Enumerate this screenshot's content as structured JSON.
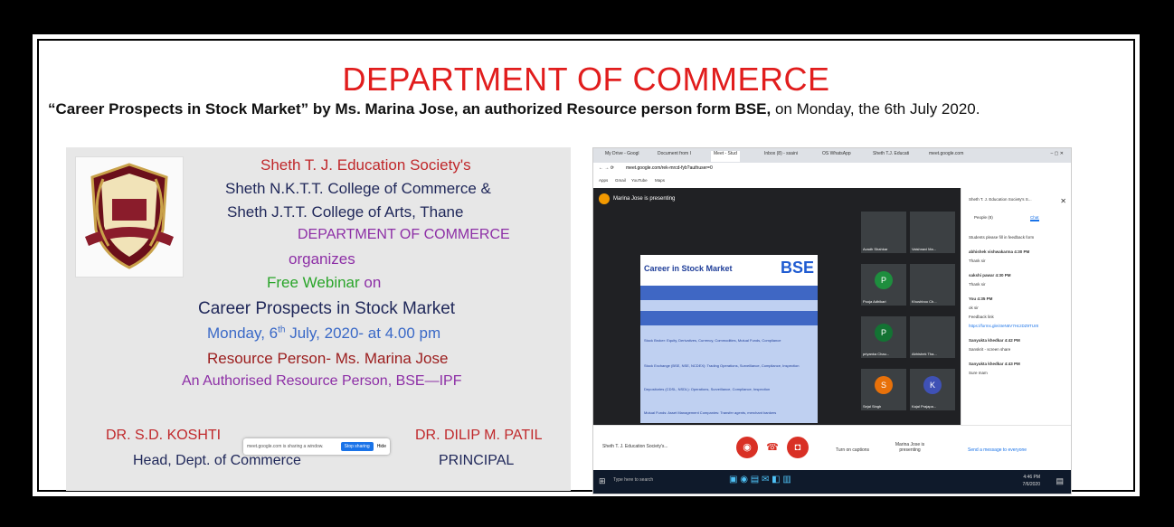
{
  "header": {
    "title": "DEPARTMENT OF COMMERCE",
    "subtitle_bold": "“Career Prospects in Stock Market” by Ms. Marina Jose, an authorized Resource person form BSE,",
    "subtitle_rest": " on Monday, the 6th July 2020."
  },
  "poster": {
    "lines": [
      "Sheth T. J. Education Society's",
      "Sheth N.K.T.T. College of Commerce  &",
      "Sheth J.T.T. College of Arts, Thane",
      "DEPARTMENT OF COMMERCE",
      "organizes",
      "Free Webinar",
      " on",
      "Career Prospects in Stock Market",
      "Monday, 6",
      "th",
      " July, 2020- at 4.00 pm",
      "Resource Person- Ms. Marina Jose",
      "An Authorised Resource Person, BSE—IPF"
    ],
    "left_sign_name": "DR. S.D. KOSHTI",
    "left_sign_title": "Head, Dept. of Commerce",
    "right_sign_name": "DR. DILIP M. PATIL",
    "right_sign_title": "PRINCIPAL",
    "share_bar_text": "meet.google.com is sharing a window.",
    "stop_sharing": "Stop sharing",
    "hide": "Hide"
  },
  "screen": {
    "tabs": [
      "My Drive - Googl",
      "Document from I",
      "Meet - Stud",
      "Inbox (8) - ssaini",
      "OS WhatsApp",
      "Sheth T.J. Educati",
      "meet.google.com"
    ],
    "url": "meet.google.com/rek-mrcd-fyb?authuser=0",
    "bookmarks": [
      "Apps",
      "Gmail",
      "YouTube",
      "Maps"
    ],
    "presenting": "Marina Jose is presenting",
    "slide_title": "Career in Stock Market",
    "slide_logo": "BSE",
    "slide_rows": [
      "Stock Broker: Equity, Derivatives, Currency, Commodities, Mutual Funds, Compliance",
      "Stock Exchange (BSE, NSE, NCDEX): Trading Operations, Surveillance, Compliance, Inspection",
      "Depositories (CDSL, NSDL): Operations, Surveillance, Compliance, Inspection",
      "Mutual Funds: Asset Management Companies: Transfer agents, merchant bankers"
    ],
    "participants": [
      "Avadh Shahkar",
      "Vaishnavi Ma...",
      "Pooja Adhikari",
      "Khushboo Ch...",
      "priyanka Chau...",
      "Abhishek Tha...",
      "Sejal Singh",
      "Kajal Prajapa..."
    ],
    "side_title": "Sheth T. J. Education Society's S...",
    "people_tab": "People (8)",
    "chat_tab": "Chat",
    "chat": [
      "Students please fill in feedback form",
      "abhishek vishwakarma 4:30 PM",
      "Thank sir",
      "sakshi pawar 4:30 PM",
      "Thank sir",
      "You 4:35 PM",
      "ok sir",
      "Feedback link",
      "https://forms.gle/4IeN6V7HczDZ9TUr8",
      "Sanyukta khedkar 4:42 PM",
      "Sanskrit - screen share",
      "Sanyukta khedkar 4:43 PM",
      "Sure mam"
    ],
    "chat_input": "Send a message to everyone",
    "meeting_name": "Sheth T. J. Education Society's...",
    "turn_on_captions": "Turn on captions",
    "marina_presenting": "Marina Jose is presenting",
    "search_placeholder": "Type here to search",
    "clock_time": "4:46 PM",
    "clock_date": "7/6/2020"
  }
}
